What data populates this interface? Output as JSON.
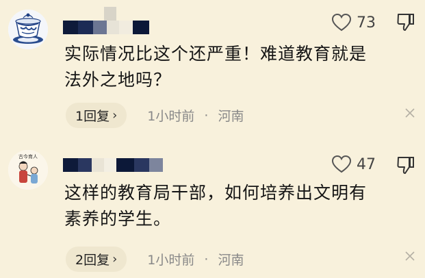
{
  "comments": [
    {
      "likes": "73",
      "text_lines": [
        "实际情况比这个还严重！难道教育就是",
        "法外之地吗？"
      ],
      "reply": "1回复",
      "time": "1小时前",
      "location": "河南"
    },
    {
      "likes": "47",
      "text_lines": [
        "这样的教育局干部，如何培养出文明有",
        "素养的学生。"
      ],
      "reply": "2回复",
      "time": "1小时前",
      "location": "河南",
      "avatar_text": "古今育人"
    }
  ],
  "sep": "·",
  "chevron": "›",
  "colors": {
    "background": "#f8f1dc",
    "text": "#151515",
    "meta": "#888888"
  },
  "icons": {
    "like": "heart-icon",
    "dislike": "thumbs-down-icon",
    "close": "close-icon"
  }
}
